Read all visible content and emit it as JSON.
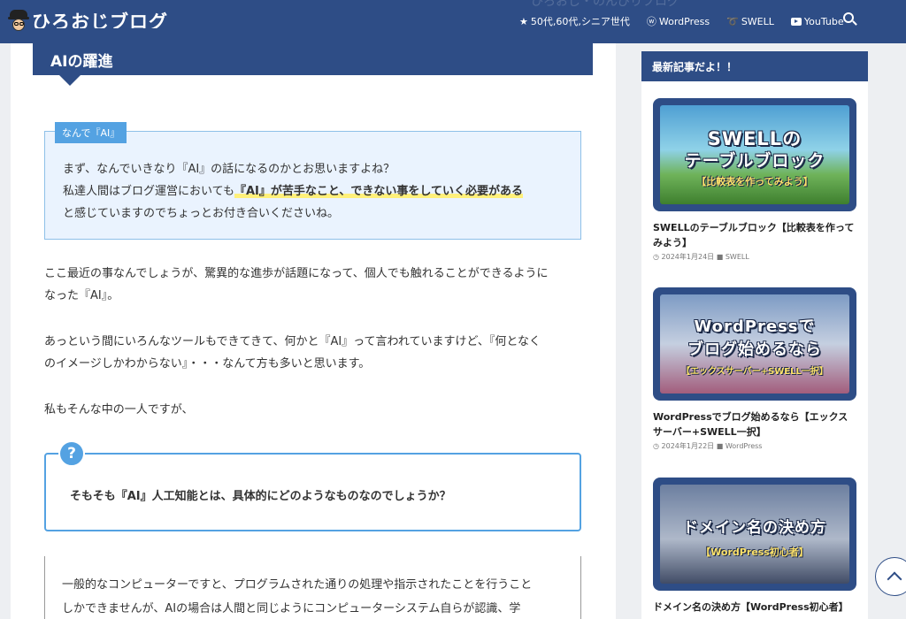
{
  "header": {
    "logo_text": "ひろおじブログ",
    "ghost_text": "ひろおじ・のんびりブログ",
    "nav": [
      {
        "icon": "star-icon",
        "glyph": "★",
        "label": "50代,60代,シニア世代"
      },
      {
        "icon": "wordpress-icon",
        "glyph": "ⓦ",
        "label": "WordPress"
      },
      {
        "icon": "swell-icon",
        "glyph": "➰",
        "label": "SWELL"
      },
      {
        "icon": "youtube-icon",
        "glyph": "",
        "label": "YouTube"
      }
    ]
  },
  "article": {
    "heading": "AIの躍進",
    "cap_box": {
      "label": "なんで『AI』",
      "line1": "まず、なんでいきなり『AI』の話になるのかとお思いますよね？",
      "line2_pre": "私達人間はブログ運営においても",
      "line2_marker": "『AI』が苦手なこと、できない事をしていく必要がある",
      "line3": "と感じていますのでちょっとお付き合いくださいね。"
    },
    "para1_line1": "ここ最近の事なんでしょうが、驚異的な進歩が話題になって、個人でも触れることができるように",
    "para1_line2": "なった『AI』。",
    "para2_line1": "あっという間にいろんなツールもできてきて、何かと『AI』って言われていますけど、『何となく",
    "para2_line2": "のイメージしかわからない』・・・なんて方も多いと思います。",
    "para3": "私もそんな中の一人ですが、",
    "question": {
      "icon": "?",
      "text": "そもそも『AI』人工知能とは、具体的にどのようなものなのでしょうか？"
    },
    "bracket_box": {
      "line1": "一般的なコンピューターですと、プログラムされた通りの処理や指示されたことを行うこと",
      "line2": "しかできませんが、AIの場合は人間と同じようにコンピューターシステム自らが認識、学"
    }
  },
  "sidebar": {
    "title": "最新記事だよ！！",
    "posts": [
      {
        "thumb_title1": "SWELLの",
        "thumb_title2": "テーブルブロック",
        "thumb_sub": "【比較表を作ってみよう】",
        "title": "SWELLのテーブルブロック【比較表を作ってみよう】",
        "date": "2024年1月24日",
        "category": "SWELL"
      },
      {
        "thumb_title1": "WordPressで",
        "thumb_title2": "ブログ始めるなら",
        "thumb_sub": "【エックスサーバー+SWELL一択】",
        "title": "WordPressでブログ始めるなら【エックスサーバー+SWELL一択】",
        "date": "2024年1月22日",
        "category": "WordPress"
      },
      {
        "thumb_title1": "ドメイン名の決め方",
        "thumb_sub": "【WordPress初心者】",
        "title": "ドメイン名の決め方【WordPress初心者】"
      }
    ]
  },
  "colors": {
    "brand": "#2e4d86",
    "accent": "#54a2e2",
    "cap_bg": "#eaf3fe",
    "marker": "#fff07a"
  }
}
